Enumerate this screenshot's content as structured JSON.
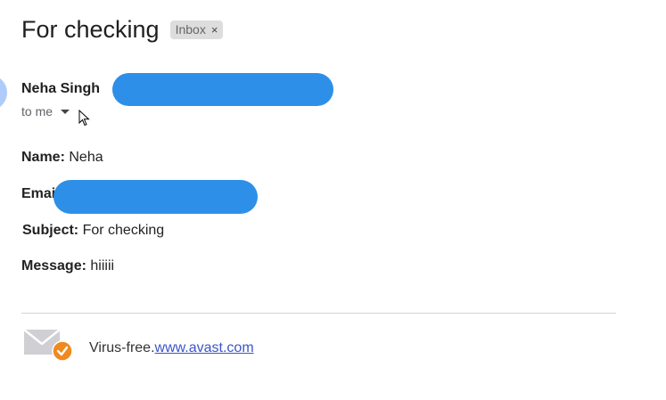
{
  "email": {
    "subject": "For checking",
    "label": "Inbox",
    "label_close": "×",
    "sender_name": "Neha Singh",
    "to_text": "to me"
  },
  "body": {
    "name_label": "Name:",
    "name_value": "Neha",
    "email_label": "Email",
    "subject_label": "Subject:",
    "subject_value": "For checking",
    "message_label": "Message:",
    "message_value": "hiiiii"
  },
  "footer": {
    "text": "Virus-free.",
    "link": "www.avast.com",
    "icon": "mail-check-icon"
  },
  "colors": {
    "redaction": "#2e8fe8",
    "avatar": "#aecbfa",
    "badge": "#f0891f",
    "link": "#3c55c8"
  }
}
